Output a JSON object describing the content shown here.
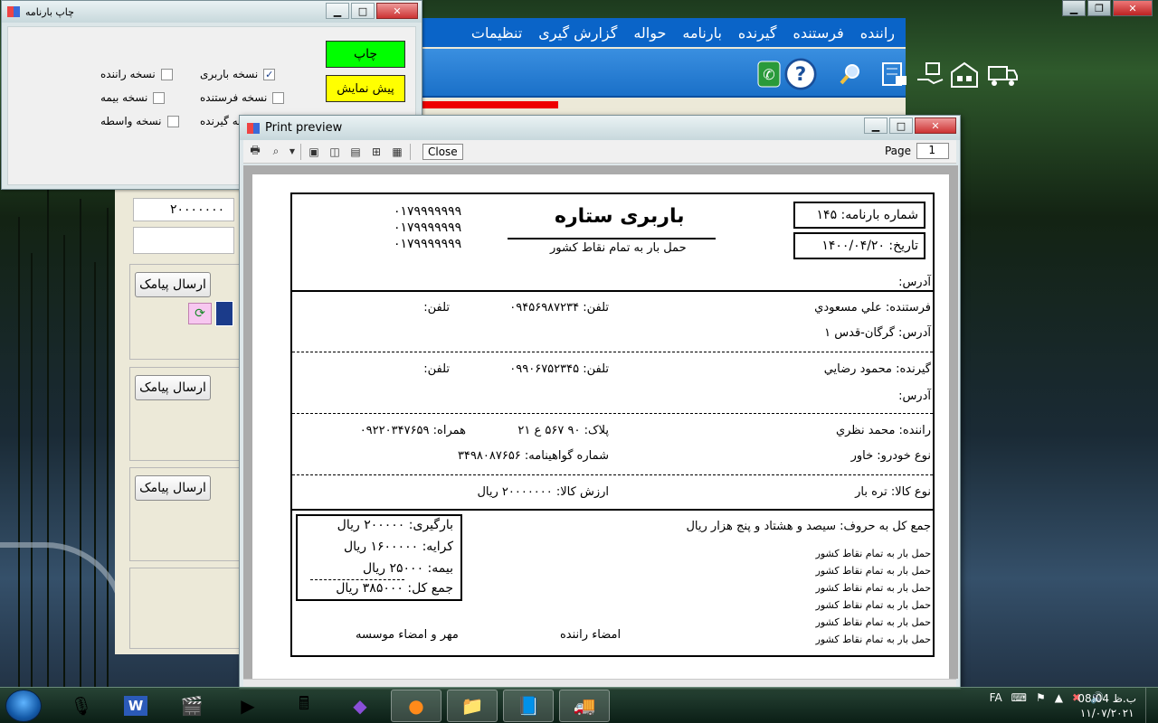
{
  "main_app": {
    "menu": [
      "راننده",
      "فرستنده",
      "گیرنده",
      "بارنامه",
      "حواله",
      "گزارش گیری",
      "تنظیمات"
    ],
    "amount_value": "۲۰۰۰۰۰۰۰",
    "sms_button_label": "ارسال پیامک"
  },
  "print_window": {
    "title": "چاپ بارنامه",
    "print_button": "چاپ",
    "preview_button": "پیش نمایش",
    "checkboxes": [
      {
        "label": "نسخه باربری",
        "checked": true
      },
      {
        "label": "نسخه فرستنده",
        "checked": false
      },
      {
        "label": "نسخه گیرنده",
        "checked": false
      },
      {
        "label": "نسخه راننده",
        "checked": false
      },
      {
        "label": "نسخه بیمه",
        "checked": false
      },
      {
        "label": "نسخه واسطه",
        "checked": false
      }
    ]
  },
  "preview_window": {
    "title": "Print preview",
    "close_label": "Close",
    "page_label": "Page",
    "page_value": "1"
  },
  "bill": {
    "phones": [
      "۰۱۷۹۹۹۹۹۹۹",
      "۰۱۷۹۹۹۹۹۹۹",
      "۰۱۷۹۹۹۹۹۹۹"
    ],
    "company_name": "باربری ستاره",
    "company_slogan": "حمل بار به تمام نقاط کشور",
    "bill_number": "شماره بارنامه: ۱۴۵",
    "date": "تاریخ: ۱۴۰۰/۰۴/۲۰",
    "address_label": "آدرس:",
    "sender": "فرستنده: علي مسعودي",
    "sender_phone1": "تلفن: ۰۹۴۵۶۹۸۷۲۳۴",
    "sender_phone2": "تلفن:",
    "sender_address": "آدرس:  گرگان-قدس ۱",
    "receiver": "گیرنده: محمود رضايي",
    "receiver_phone1": "تلفن: ۰۹۹۰۶۷۵۲۳۴۵",
    "receiver_phone2": "تلفن:",
    "receiver_address": "آدرس:",
    "driver": "راننده: محمد نظري",
    "plate": "پلاک: ۹۰ ۵۶۷ ع ۲۱",
    "mobile": "همراه: ۰۹۲۲۰۳۴۷۶۵۹",
    "vehicle_type": "نوع خودرو: خاور",
    "license_no": "شماره گواهینامه: ۳۴۹۸۰۸۷۶۵۶",
    "goods_type": "نوع کالا: تره بار",
    "goods_value": "ارزش کالا: ۲۰۰۰۰۰۰۰ ریال",
    "total_words": "جمع کل به حروف: سیصد و هشتاد و پنج هزار ریال",
    "notes": [
      "حمل بار به تمام نقاط کشور",
      "حمل بار به تمام نقاط کشور",
      "حمل بار به تمام نقاط کشور",
      "حمل بار به تمام نقاط کشور",
      "حمل بار به تمام نقاط کشور",
      "حمل بار به تمام نقاط کشور"
    ],
    "loading_fee": "بارگیری: ۲۰۰۰۰۰ ریال",
    "fare": "کرایه: ۱۶۰۰۰۰۰ ریال",
    "insurance": "بیمه: ۲۵۰۰۰ ریال",
    "total": "جمع کل: ۳۸۵۰۰۰ ریال",
    "driver_signature": "امضاء راننده",
    "company_seal": "مهر و امضاء موسسه"
  },
  "taskbar": {
    "lang": "FA",
    "time": "08:04 ب.ظ",
    "date": "۱۱/۰۷/۲۰۲۱"
  }
}
